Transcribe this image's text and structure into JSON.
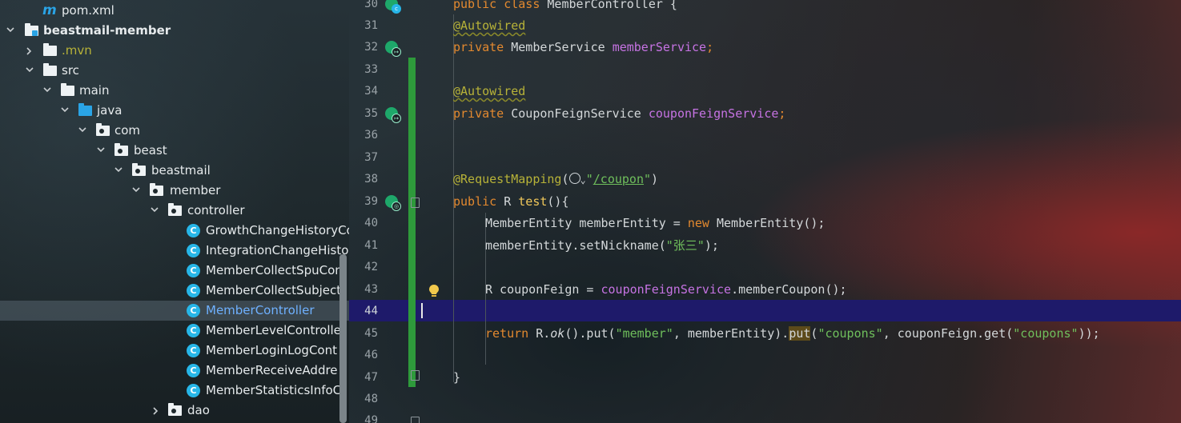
{
  "project_tree": {
    "items": [
      {
        "label": "pom.xml",
        "type": "maven",
        "depth": 0
      },
      {
        "label": "beastmail-member",
        "type": "module",
        "depth": 0,
        "expanded": true
      },
      {
        "label": ".mvn",
        "type": "folder",
        "depth": 1,
        "expanded": false
      },
      {
        "label": "src",
        "type": "folder",
        "depth": 1,
        "expanded": true
      },
      {
        "label": "main",
        "type": "folder",
        "depth": 2,
        "expanded": true
      },
      {
        "label": "java",
        "type": "source-folder",
        "depth": 3,
        "expanded": true
      },
      {
        "label": "com",
        "type": "package",
        "depth": 4,
        "expanded": true
      },
      {
        "label": "beast",
        "type": "package",
        "depth": 5,
        "expanded": true
      },
      {
        "label": "beastmail",
        "type": "package",
        "depth": 6,
        "expanded": true
      },
      {
        "label": "member",
        "type": "package",
        "depth": 7,
        "expanded": true
      },
      {
        "label": "controller",
        "type": "package",
        "depth": 8,
        "expanded": true
      },
      {
        "label": "GrowthChangeHistoryCo",
        "type": "class",
        "depth": 9
      },
      {
        "label": "IntegrationChangeHistor",
        "type": "class",
        "depth": 9
      },
      {
        "label": "MemberCollectSpuCon",
        "type": "class",
        "depth": 9
      },
      {
        "label": "MemberCollectSubject",
        "type": "class",
        "depth": 9
      },
      {
        "label": "MemberController",
        "type": "class",
        "depth": 9,
        "selected": true
      },
      {
        "label": "MemberLevelControlle",
        "type": "class",
        "depth": 9
      },
      {
        "label": "MemberLoginLogCont",
        "type": "class",
        "depth": 9
      },
      {
        "label": "MemberReceiveAddre",
        "type": "class",
        "depth": 9
      },
      {
        "label": "MemberStatisticsInfoC",
        "type": "class",
        "depth": 9
      },
      {
        "label": "dao",
        "type": "package",
        "depth": 8,
        "expanded": false
      }
    ]
  },
  "editor": {
    "current_line": "44",
    "lines": [
      {
        "num": "30",
        "text": "public class MemberController {"
      },
      {
        "num": "31",
        "text": "@Autowired"
      },
      {
        "num": "32",
        "text": "private MemberService memberService;"
      },
      {
        "num": "33",
        "text": ""
      },
      {
        "num": "34",
        "text": "@Autowired"
      },
      {
        "num": "35",
        "text": "private CouponFeignService couponFeignService;"
      },
      {
        "num": "36",
        "text": ""
      },
      {
        "num": "37",
        "text": ""
      },
      {
        "num": "38",
        "text": "@RequestMapping(\"/coupon\")"
      },
      {
        "num": "39",
        "text": "public R test(){"
      },
      {
        "num": "40",
        "text": "MemberEntity memberEntity = new MemberEntity();"
      },
      {
        "num": "41",
        "text": "memberEntity.setNickname(\"张三\");"
      },
      {
        "num": "42",
        "text": ""
      },
      {
        "num": "43",
        "text": "R couponFeign = couponFeignService.memberCoupon();"
      },
      {
        "num": "44",
        "text": ""
      },
      {
        "num": "45",
        "text": "return R.ok().put(\"member\", memberEntity).put(\"coupons\", couponFeign.get(\"coupons\"));"
      },
      {
        "num": "46",
        "text": ""
      },
      {
        "num": "47",
        "text": "}"
      },
      {
        "num": "48",
        "text": ""
      },
      {
        "num": "49",
        "text": ""
      }
    ],
    "tokens": {
      "l30_kw1": "public",
      "l30_kw2": "class",
      "l30_name": "MemberController {",
      "l31_ann": "@Autowired",
      "l32_kw": "private",
      "l32_type": " MemberService ",
      "l32_fld": "memberService",
      "l32_semi": ";",
      "l34_ann": "@Autowired",
      "l35_kw": "private",
      "l35_type": " CouponFeignService ",
      "l35_fld": "couponFeignService",
      "l35_semi": ";",
      "l38_ann": "@RequestMapping",
      "l38_open": "(",
      "l38_chev": "⌄",
      "l38_q1": "\"",
      "l38_url": "/coupon",
      "l38_q2": "\"",
      "l38_close": ")",
      "l39_kw": "public",
      "l39_type": " R ",
      "l39_fn": "test",
      "l39_rest": "(){",
      "l40_a": "MemberEntity memberEntity = ",
      "l40_kw": "new",
      "l40_b": " MemberEntity();",
      "l41_a": "memberEntity.setNickname(",
      "l41_str": "\"张三\"",
      "l41_b": ");",
      "l43_a": "R couponFeign = ",
      "l43_fld": "couponFeignService",
      "l43_b": ".memberCoupon();",
      "l45_kw": "return",
      "l45_a": " R.",
      "l45_ok": "ok",
      "l45_b": "().put(",
      "l45_s1": "\"member\"",
      "l45_c": ", memberEntity).",
      "l45_put": "put",
      "l45_d": "(",
      "l45_s2": "\"coupons\"",
      "l45_e": ", couponFeign.get(",
      "l45_s3": "\"coupons\"",
      "l45_f": "));",
      "l47": "}"
    }
  },
  "colors": {
    "keyword": "#e3892f",
    "annotation": "#b7b238",
    "field": "#c673e3",
    "string": "#6fbf5c",
    "method": "#f0c75a",
    "change_bar": "#2e9a3b",
    "caret_row": "#1e1a6a",
    "class_icon": "#27b6e8"
  }
}
